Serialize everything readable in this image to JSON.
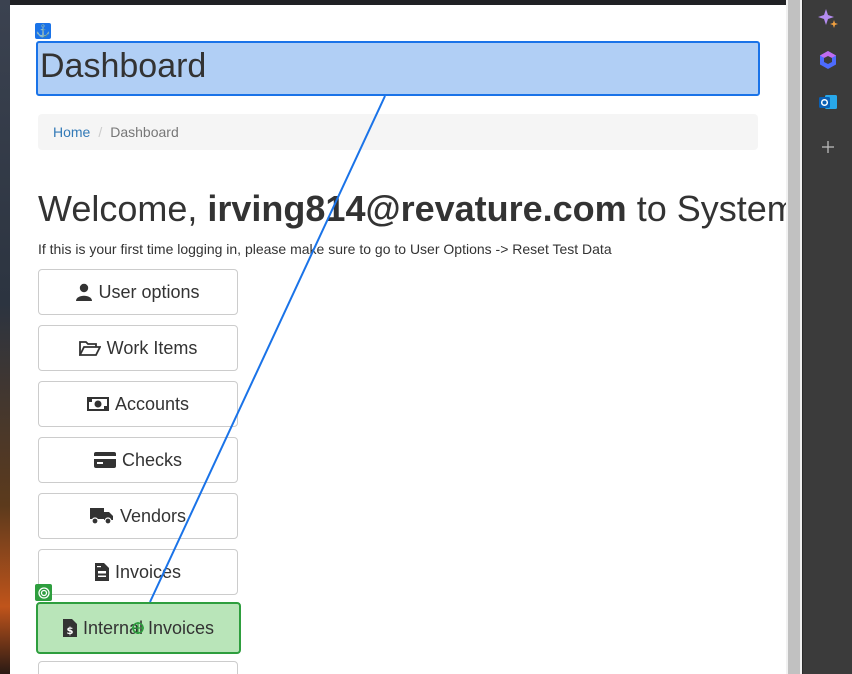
{
  "page": {
    "title": "Dashboard",
    "breadcrumb": {
      "home": "Home",
      "current": "Dashboard"
    },
    "welcome": {
      "prefix": "Welcome, ",
      "email": "irving814@revature.com",
      "suffix": " to System"
    },
    "hint": "If this is your first time logging in, please make sure to go to User Options -> Reset Test Data"
  },
  "menu": [
    {
      "label": "User options",
      "icon": "user-icon"
    },
    {
      "label": "Work Items",
      "icon": "folder-open-icon"
    },
    {
      "label": "Accounts",
      "icon": "money-bill-icon"
    },
    {
      "label": "Checks",
      "icon": "credit-card-icon"
    },
    {
      "label": "Vendors",
      "icon": "truck-icon"
    },
    {
      "label": "Invoices",
      "icon": "file-invoice-icon"
    },
    {
      "label": "Internal Invoices",
      "icon": "file-invoice-dollar-icon"
    }
  ],
  "colors": {
    "anchor": "#1a73e8",
    "target": "#2e9e3e",
    "link": "#337ab7"
  }
}
